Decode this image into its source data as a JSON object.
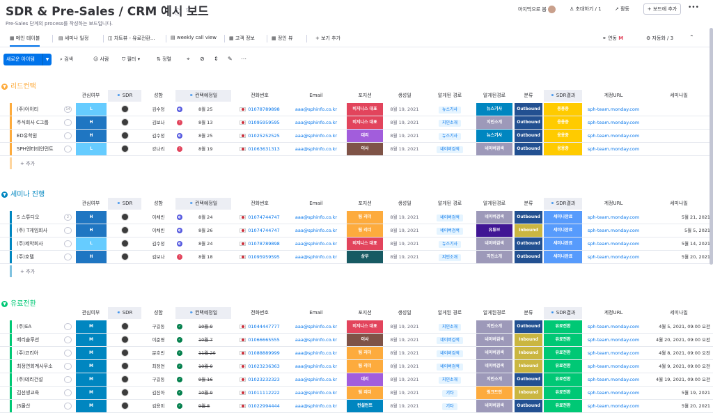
{
  "header": {
    "title": "SDR & Pre-Sales / CRM 예시 보드",
    "subtitle": "Pre-Sales 단계의 process를 작성하는 보드입니다.",
    "last_seen": "마지막으로 봄",
    "invite": "초대하기 / 1",
    "activity": "활동",
    "add_to_board": "+ 보드에 추가",
    "more": "•••"
  },
  "tabs": [
    {
      "icon": "▦",
      "label": "메인 테이블"
    },
    {
      "icon": "▤",
      "label": "세미나 일정"
    },
    {
      "icon": "◫",
      "label": "차트뷰 - 유료전환..."
    },
    {
      "icon": "▤",
      "label": "weekly call view"
    },
    {
      "icon": "▦",
      "label": "고객 정보"
    },
    {
      "icon": "▦",
      "label": "정인 뷰"
    },
    {
      "icon": "+",
      "label": "보기 추가"
    }
  ],
  "tab_right": {
    "integrate": "연동",
    "automate": "자동화 / 3"
  },
  "toolbar": {
    "new_item": "새로운 아이템",
    "search": "검색",
    "person": "사람",
    "filter": "필터",
    "sort": "정렬"
  },
  "columns": {
    "interest": "관심여부",
    "sdr": "SDR",
    "owner": "성함",
    "contact": "컨택예정일",
    "phone": "전화번호",
    "email": "Email",
    "position": "포지션",
    "birthday": "생성일",
    "known": "알게된 경로",
    "known2": "알게된경로",
    "category": "분류",
    "sdr_result": "SDR결과",
    "account": "계정URL",
    "seminar": "세미나일"
  },
  "colors": {
    "orange": "#fdab3d",
    "blue": "#0086c0",
    "green": "#00c875",
    "red": "#e2445c",
    "brown": "#7f5347",
    "purple": "#a25ddc",
    "darkblue": "#225091",
    "yellow": "#ffcb00",
    "navy": "#401694",
    "lightblue": "#579bfc",
    "darkgreen": "#037f4c"
  },
  "groups": [
    {
      "title": "리드컨택",
      "color": "#fdab3d",
      "add": "+ 추가",
      "rows": [
        {
          "name": "(주)아이티",
          "chat": "14",
          "level": "L",
          "levelColor": "#66ccff",
          "owner": "김수정",
          "statusColor": "#5559df",
          "status": "◐",
          "date": "8월 25",
          "strike": false,
          "phone": "01078789898",
          "email": "aaa@sphinfo.co.kr",
          "pos": "비지니스 대표",
          "posColor": "#e2445c",
          "created": "8월 19, 2021",
          "known": "뉴스기사",
          "known2": "뉴스기사",
          "known2Color": "#0086c0",
          "cat": "Outbound",
          "catColor": "#225091",
          "res": "응용중",
          "resColor": "#ffcb00",
          "url": "sph-team.monday.com",
          "sem": ""
        },
        {
          "name": "주식회사 C그룹",
          "chat": "",
          "level": "H",
          "levelColor": "#1f76c2",
          "owner": "김보나",
          "statusColor": "#e2445c",
          "status": "!",
          "date": "8월 13",
          "strike": false,
          "phone": "01095959595",
          "email": "aaa@sphinfo.co.kr",
          "pos": "비지니스 대표",
          "posColor": "#e2445c",
          "created": "8월 19, 2021",
          "known": "지인소개",
          "known2": "지인소개",
          "known2Color": "#9d99b9",
          "cat": "Outbound",
          "catColor": "#225091",
          "res": "응용중",
          "resColor": "#ffcb00",
          "url": "sph-team.monday.com",
          "sem": ""
        },
        {
          "name": "ED유학원",
          "chat": "",
          "level": "H",
          "levelColor": "#1f76c2",
          "owner": "김수정",
          "statusColor": "#5559df",
          "status": "◐",
          "date": "8월 25",
          "strike": false,
          "phone": "01025252525",
          "email": "aaa@sphinfo.co.kr",
          "pos": "대리",
          "posColor": "#a25ddc",
          "created": "8월 19, 2021",
          "known": "뉴스기사",
          "known2": "뉴스기사",
          "known2Color": "#0086c0",
          "cat": "Outbound",
          "catColor": "#225091",
          "res": "응용중",
          "resColor": "#ffcb00",
          "url": "sph-team.monday.com",
          "sem": ""
        },
        {
          "name": "SPH엔터테인먼트",
          "chat": "",
          "level": "L",
          "levelColor": "#66ccff",
          "owner": "강나리",
          "statusColor": "#e2445c",
          "status": "!",
          "date": "8월 19",
          "strike": false,
          "phone": "01063631313",
          "email": "aaa@sphinfo.co.kr",
          "pos": "이사",
          "posColor": "#7f5347",
          "created": "8월 19, 2021",
          "known": "네이버검색",
          "known2": "네이버검색",
          "known2Color": "#9d99b9",
          "cat": "Outbound",
          "catColor": "#225091",
          "res": "응용중",
          "resColor": "#ffcb00",
          "url": "sph-team.monday.com",
          "sem": ""
        }
      ]
    },
    {
      "title": "세미나 진행",
      "color": "#0086c0",
      "add": "+ 추가",
      "rows": [
        {
          "name": "S 스튜디오",
          "chat": "2",
          "level": "H",
          "levelColor": "#1f76c2",
          "owner": "이채빈",
          "statusColor": "#5559df",
          "status": "◐",
          "date": "8월 24",
          "strike": false,
          "phone": "01074744747",
          "email": "aaa@sphinfo.co.kr",
          "pos": "팀 리더",
          "posColor": "#fdab3d",
          "created": "8월 19, 2021",
          "known": "네이버검색",
          "known2": "네이버검색",
          "known2Color": "#9d99b9",
          "cat": "Outbound",
          "catColor": "#225091",
          "res": "세미나완료",
          "resColor": "#579bfc",
          "url": "sph-team.monday.com",
          "sem": "5월 21, 2021"
        },
        {
          "name": "(주) T게임회사",
          "chat": "",
          "level": "H",
          "levelColor": "#1f76c2",
          "owner": "이채빈",
          "statusColor": "#5559df",
          "status": "◐",
          "date": "8월 26",
          "strike": false,
          "phone": "01074744747",
          "email": "aaa@sphinfo.co.kr",
          "pos": "팀 리더",
          "posColor": "#fdab3d",
          "created": "8월 19, 2021",
          "known": "네이버검색",
          "known2": "유튜브",
          "known2Color": "#401694",
          "cat": "Inbound",
          "catColor": "#cab641",
          "res": "세미나완료",
          "resColor": "#579bfc",
          "url": "sph-team.monday.com",
          "sem": "5월 5, 2021"
        },
        {
          "name": "(주)제약회사",
          "chat": "",
          "level": "L",
          "levelColor": "#66ccff",
          "owner": "김수정",
          "statusColor": "#5559df",
          "status": "◐",
          "date": "8월 24",
          "strike": false,
          "phone": "01078789898",
          "email": "aaa@sphinfo.co.kr",
          "pos": "비지니스 대표",
          "posColor": "#e2445c",
          "created": "8월 19, 2021",
          "known": "뉴스기사",
          "known2": "네이버검색",
          "known2Color": "#9d99b9",
          "cat": "Outbound",
          "catColor": "#225091",
          "res": "세미나완료",
          "resColor": "#579bfc",
          "url": "sph-team.monday.com",
          "sem": "5월 14, 2021"
        },
        {
          "name": "(주)호텔",
          "chat": "",
          "level": "H",
          "levelColor": "#1f76c2",
          "owner": "김보나",
          "statusColor": "#e2445c",
          "status": "!",
          "date": "8월 18",
          "strike": false,
          "phone": "01095959595",
          "email": "aaa@sphinfo.co.kr",
          "pos": "상무",
          "posColor": "#175a63",
          "created": "8월 19, 2021",
          "known": "지인소개",
          "known2": "지인소개",
          "known2Color": "#9d99b9",
          "cat": "Outbound",
          "catColor": "#225091",
          "res": "세미나완료",
          "resColor": "#579bfc",
          "url": "sph-team.monday.com",
          "sem": "5월 20, 2021"
        }
      ]
    },
    {
      "title": "유료전환",
      "color": "#00c875",
      "add": "",
      "rows": [
        {
          "name": "(주)EA",
          "chat": "",
          "level": "M",
          "levelColor": "#0086c0",
          "owner": "구길동",
          "statusColor": "#037f4c",
          "status": "✓",
          "date": "10월 9",
          "strike": true,
          "phone": "01044447777",
          "email": "aaa@sphinfo.co.kr",
          "pos": "비지니스 대표",
          "posColor": "#e2445c",
          "created": "8월 19, 2021",
          "known": "지인소개",
          "known2": "지인소개",
          "known2Color": "#9d99b9",
          "cat": "Outbound",
          "catColor": "#225091",
          "res": "유료전환",
          "resColor": "#00c875",
          "url": "sph-team.monday.com",
          "sem": "4월 5, 2021, 09:00 오전"
        },
        {
          "name": "베리솔루션",
          "chat": "",
          "level": "M",
          "levelColor": "#0086c0",
          "owner": "이준영",
          "statusColor": "#037f4c",
          "status": "✓",
          "date": "10월 7",
          "strike": true,
          "phone": "01066665555",
          "email": "aaa@sphinfo.co.kr",
          "pos": "이사",
          "posColor": "#7f5347",
          "created": "8월 19, 2021",
          "known": "네이버검색",
          "known2": "네이버검색",
          "known2Color": "#9d99b9",
          "cat": "Inbound",
          "catColor": "#cab641",
          "res": "유료전환",
          "resColor": "#00c875",
          "url": "sph-team.monday.com",
          "sem": "4월 20, 2021, 09:00 오전"
        },
        {
          "name": "(주)코리아",
          "chat": "",
          "level": "M",
          "levelColor": "#0086c0",
          "owner": "문호빈",
          "statusColor": "#037f4c",
          "status": "✓",
          "date": "11월 20",
          "strike": true,
          "phone": "01088889999",
          "email": "aaa@sphinfo.co.kr",
          "pos": "팀 리더",
          "posColor": "#fdab3d",
          "created": "8월 19, 2021",
          "known": "네이버검색",
          "known2": "네이버검색",
          "known2Color": "#9d99b9",
          "cat": "Inbound",
          "catColor": "#cab641",
          "res": "유료전환",
          "resColor": "#00c875",
          "url": "sph-team.monday.com",
          "sem": "4월 8, 2021, 09:00 오전"
        },
        {
          "name": "최정연회계사무소",
          "chat": "",
          "level": "M",
          "levelColor": "#0086c0",
          "owner": "최정연",
          "statusColor": "#037f4c",
          "status": "✓",
          "date": "10월 9",
          "strike": true,
          "phone": "01023236363",
          "email": "aaa@sphinfo.co.kr",
          "pos": "팀 리더",
          "posColor": "#fdab3d",
          "created": "8월 19, 2021",
          "known": "네이버검색",
          "known2": "네이버검색",
          "known2Color": "#9d99b9",
          "cat": "Inbound",
          "catColor": "#cab641",
          "res": "유료전환",
          "resColor": "#00c875",
          "url": "sph-team.monday.com",
          "sem": "4월 9, 2021, 09:00 오전"
        },
        {
          "name": "(주)테리건설",
          "chat": "",
          "level": "M",
          "levelColor": "#0086c0",
          "owner": "구길동",
          "statusColor": "#037f4c",
          "status": "✓",
          "date": "9월 16",
          "strike": true,
          "phone": "01023232323",
          "email": "aaa@sphinfo.co.kr",
          "pos": "대리",
          "posColor": "#a25ddc",
          "created": "8월 19, 2021",
          "known": "지인소개",
          "known2": "지인소개",
          "known2Color": "#9d99b9",
          "cat": "Outbound",
          "catColor": "#225091",
          "res": "유료전환",
          "resColor": "#00c875",
          "url": "sph-team.monday.com",
          "sem": "4월 19, 2021, 09:00 오전"
        },
        {
          "name": "김선생교육",
          "chat": "",
          "level": "M",
          "levelColor": "#0086c0",
          "owner": "김진아",
          "statusColor": "#037f4c",
          "status": "✓",
          "date": "10월 9",
          "strike": true,
          "phone": "01011112222",
          "email": "aaa@sphinfo.co.kr",
          "pos": "팀 리더",
          "posColor": "#fdab3d",
          "created": "8월 19, 2021",
          "known": "기타",
          "known2": "링크드인",
          "known2Color": "#fdab3d",
          "cat": "Inbound",
          "catColor": "#cab641",
          "res": "유료전환",
          "resColor": "#00c875",
          "url": "sph-team.monday.com",
          "sem": "5월 19, 2021"
        },
        {
          "name": "JS물산",
          "chat": "",
          "level": "M",
          "levelColor": "#0086c0",
          "owner": "김용미",
          "statusColor": "#037f4c",
          "status": "✓",
          "date": "9월 8",
          "strike": true,
          "phone": "01022994444",
          "email": "aaa@sphinfo.co.kr",
          "pos": "컨설턴트",
          "posColor": "#0086c0",
          "created": "8월 19, 2021",
          "known": "기타",
          "known2": "네이버검색",
          "known2Color": "#9d99b9",
          "cat": "Outbound",
          "catColor": "#225091",
          "res": "유료전환",
          "resColor": "#00c875",
          "url": "sph-team.monday.com",
          "sem": "5월 20, 2021"
        }
      ]
    }
  ]
}
